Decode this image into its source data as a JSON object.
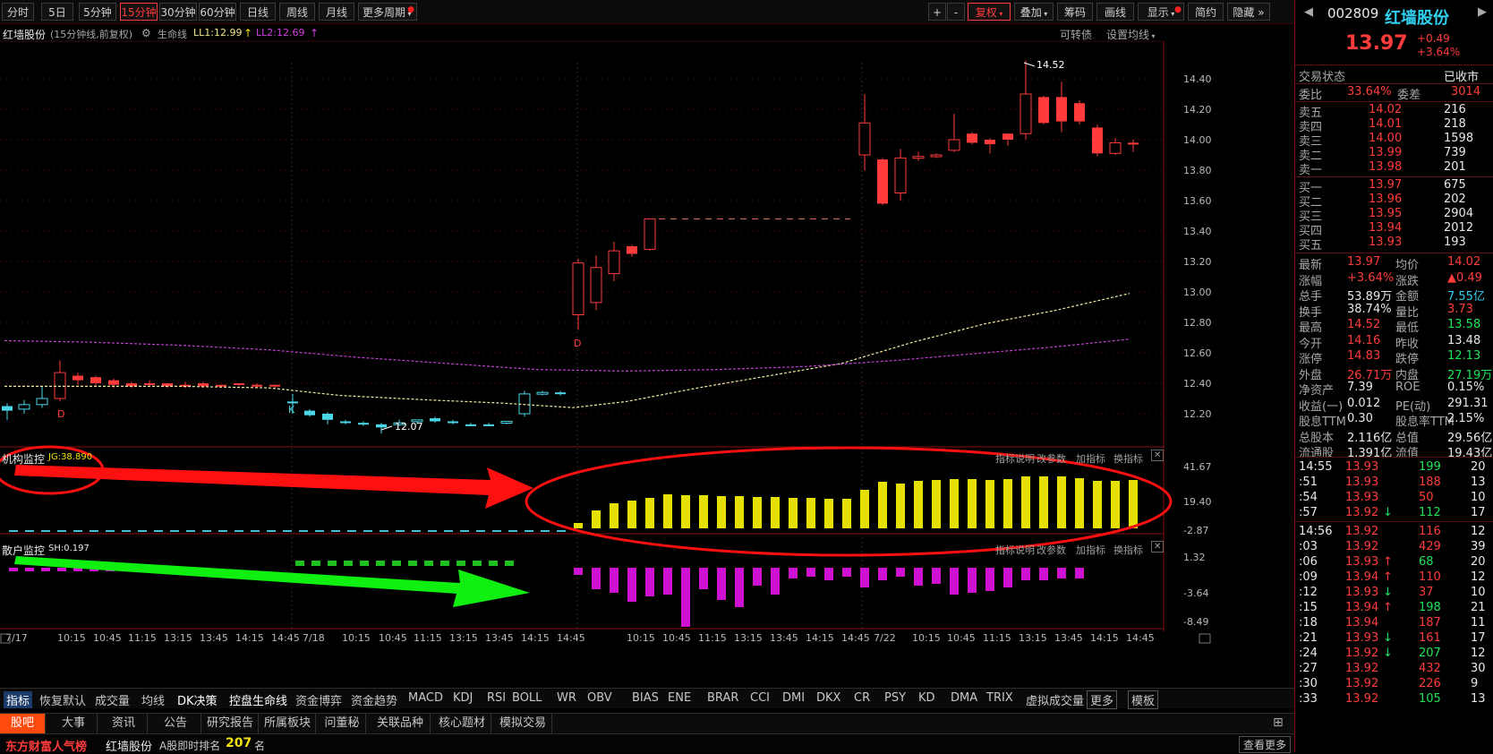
{
  "toolbar": {
    "periods": [
      "分时",
      "5日",
      "5分钟",
      "15分钟",
      "30分钟",
      "60分钟",
      "日线",
      "周线",
      "月线",
      "更多周期"
    ],
    "active_period": "15分钟",
    "right_buttons": [
      "+",
      "-",
      "复权",
      "叠加",
      "筹码",
      "画线",
      "显示",
      "简约",
      "隐藏"
    ]
  },
  "info": {
    "stock_name": "红墙股份",
    "mode": "(15分钟线,前复权)",
    "ll1_label": "生命线",
    "ll1": "LL1:12.99",
    "ll2": "LL2:12.69",
    "convertible": "可转债",
    "set_ma": "设置均线"
  },
  "price_axis": [
    "14.40",
    "14.20",
    "14.00",
    "13.80",
    "13.60",
    "13.40",
    "13.20",
    "13.00",
    "12.80",
    "12.60",
    "12.40",
    "12.20"
  ],
  "annotations": {
    "high": "14.52",
    "low": "12.07",
    "d1": "D",
    "d2": "D",
    "k": "K"
  },
  "panel1": {
    "title": "机构监控",
    "value": "JG:38.890",
    "axis": [
      "41.67",
      "19.40",
      "-2.87"
    ],
    "links": [
      "指标说明",
      "改参数",
      "加指标",
      "换指标"
    ]
  },
  "panel2": {
    "title": "散户监控",
    "value": "SH:0.197",
    "axis": [
      "1.32",
      "-3.64",
      "-8.49"
    ],
    "links": [
      "指标说明",
      "改参数",
      "加指标",
      "换指标"
    ]
  },
  "time_axis": [
    "7/17",
    "10:15",
    "10:45",
    "11:15",
    "13:15",
    "13:45",
    "14:15",
    "14:45",
    "7/18",
    "10:15",
    "10:45",
    "11:15",
    "13:15",
    "13:45",
    "14:15",
    "14:45",
    "10:15",
    "10:45",
    "11:15",
    "13:15",
    "13:45",
    "14:15",
    "14:45",
    "7/22",
    "10:15",
    "10:45",
    "11:15",
    "13:15",
    "13:45",
    "14:15",
    "14:45"
  ],
  "indicator_tabs": [
    "指标",
    "恢复默认",
    "成交量",
    "均线",
    "DK决策",
    "控盘生命线",
    "资金博弈",
    "资金趋势",
    "MACD",
    "KDJ",
    "RSI",
    "BOLL",
    "WR",
    "OBV",
    "BIAS",
    "ENE",
    "BRAR",
    "CCI",
    "DMI",
    "DKX",
    "CR",
    "PSY",
    "KD",
    "DMA",
    "TRIX",
    "虚拟成交量",
    "更多",
    "模板"
  ],
  "bottom_tabs": [
    "股吧",
    "大事",
    "资讯",
    "公告",
    "研究报告",
    "所属板块",
    "问董秘",
    "关联品种",
    "核心题材",
    "模拟交易"
  ],
  "statusbar": {
    "brand": "东方财富人气榜",
    "stock": "红墙股份",
    "rank_label": "A股即时排名",
    "rank": "207",
    "rank_unit": "名",
    "more": "查看更多"
  },
  "quote": {
    "code": "002809",
    "name": "红墙股份",
    "price": "13.97",
    "change": "+0.49",
    "pct": "+3.64%",
    "status_label": "交易状态",
    "status": "已收市",
    "wb_label": "委比",
    "wb": "33.64%",
    "wc_label": "委差",
    "wc": "3014",
    "asks": [
      [
        "卖五",
        "14.02",
        "216"
      ],
      [
        "卖四",
        "14.01",
        "218"
      ],
      [
        "卖三",
        "14.00",
        "1598"
      ],
      [
        "卖二",
        "13.99",
        "739"
      ],
      [
        "卖一",
        "13.98",
        "201"
      ]
    ],
    "bids": [
      [
        "买一",
        "13.97",
        "675"
      ],
      [
        "买二",
        "13.96",
        "202"
      ],
      [
        "买三",
        "13.95",
        "2904"
      ],
      [
        "买四",
        "13.94",
        "2012"
      ],
      [
        "买五",
        "13.93",
        "193"
      ]
    ],
    "stats": [
      [
        "最新",
        "13.97",
        "均价",
        "14.02"
      ],
      [
        "涨幅",
        "+3.64%",
        "涨跌",
        "▲0.49"
      ],
      [
        "总手",
        "53.89万",
        "金额",
        "7.55亿"
      ],
      [
        "换手",
        "38.74%",
        "量比",
        "3.73"
      ],
      [
        "最高",
        "14.52",
        "最低",
        "13.58"
      ],
      [
        "今开",
        "14.16",
        "昨收",
        "13.48"
      ],
      [
        "涨停",
        "14.83",
        "跌停",
        "12.13"
      ],
      [
        "外盘",
        "26.71万",
        "内盘",
        "27.19万"
      ],
      [
        "净资产",
        "7.39",
        "ROE",
        "0.15%"
      ],
      [
        "收益(一)",
        "0.012",
        "PE(动)",
        "291.31"
      ],
      [
        "股息TTM",
        "0.30",
        "股息率TTM",
        "2.15%"
      ],
      [
        "总股本",
        "2.116亿",
        "总值",
        "29.56亿"
      ],
      [
        "流通股",
        "1.391亿",
        "流值",
        "19.43亿"
      ]
    ],
    "ticks": [
      [
        "14:55",
        "13.93",
        "",
        "199",
        "20"
      ],
      [
        ":51",
        "13.93",
        "",
        "188",
        "13"
      ],
      [
        ":54",
        "13.93",
        "",
        "50",
        "10"
      ],
      [
        ":57",
        "13.92",
        "↓",
        "112",
        "17"
      ],
      [
        "14:56",
        "13.92",
        "",
        "116",
        "12"
      ],
      [
        ":03",
        "13.92",
        "",
        "429",
        "39"
      ],
      [
        ":06",
        "13.93",
        "↑",
        "68",
        "20"
      ],
      [
        ":09",
        "13.94",
        "↑",
        "110",
        "12"
      ],
      [
        ":12",
        "13.93",
        "↓",
        "37",
        "10"
      ],
      [
        ":15",
        "13.94",
        "↑",
        "198",
        "21"
      ],
      [
        ":18",
        "13.94",
        "",
        "187",
        "11"
      ],
      [
        ":21",
        "13.93",
        "↓",
        "161",
        "17"
      ],
      [
        ":24",
        "13.92",
        "↓",
        "207",
        "12"
      ],
      [
        ":27",
        "13.92",
        "",
        "432",
        "30"
      ],
      [
        ":30",
        "13.92",
        "",
        "226",
        "9"
      ],
      [
        ":33",
        "13.92",
        "",
        "105",
        "13"
      ]
    ]
  },
  "chart_data": {
    "type": "candlestick",
    "price_range": [
      12.07,
      14.52
    ],
    "panel1_range": [
      -2.87,
      41.67
    ],
    "panel2_range": [
      -8.49,
      1.32
    ]
  }
}
